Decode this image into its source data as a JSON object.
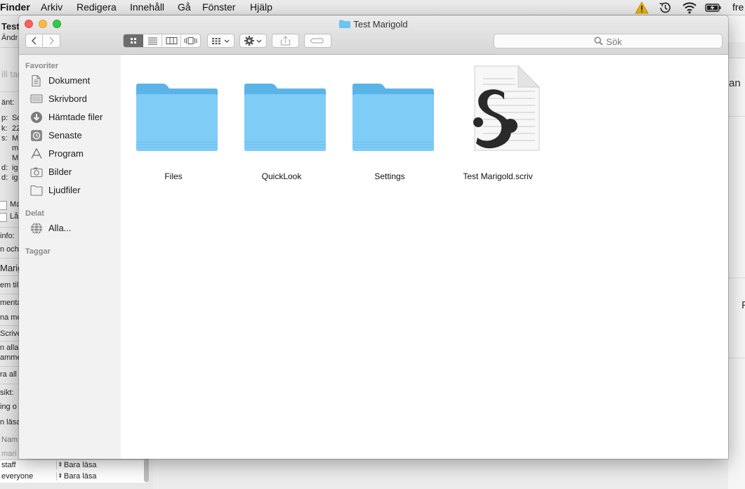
{
  "menubar": {
    "app_name": "Finder",
    "items": [
      "Arkiv",
      "Redigera",
      "Innehåll",
      "Gå",
      "Fönster",
      "Hjälp"
    ],
    "clock_partial": "fre"
  },
  "finder_window": {
    "title": "Test Marigold",
    "search_placeholder": "Sök",
    "sidebar": {
      "favorites_header": "Favoriter",
      "favorites": [
        {
          "label": "Dokument",
          "icon": "documents-icon"
        },
        {
          "label": "Skrivbord",
          "icon": "desktop-icon"
        },
        {
          "label": "Hämtade filer",
          "icon": "downloads-icon"
        },
        {
          "label": "Senaste",
          "icon": "recents-icon"
        },
        {
          "label": "Program",
          "icon": "applications-icon"
        },
        {
          "label": "Bilder",
          "icon": "pictures-icon"
        },
        {
          "label": "Ljudfiler",
          "icon": "music-icon"
        }
      ],
      "shared_header": "Delat",
      "shared": [
        {
          "label": "Alla...",
          "icon": "network-icon"
        }
      ],
      "tags_header": "Taggar"
    },
    "files": [
      {
        "name": "Files",
        "kind": "folder"
      },
      {
        "name": "QuickLook",
        "kind": "folder"
      },
      {
        "name": "Settings",
        "kind": "folder"
      },
      {
        "name": "Test Marigold.scriv",
        "kind": "scrivener-document"
      }
    ]
  },
  "background_info_window": {
    "fragments": [
      "Test",
      "Ändr",
      "ill tag",
      "änt:",
      "p:",
      "Sc",
      "k:",
      "22",
      "s:",
      "M",
      "m",
      "M",
      "d:",
      "ig",
      "d:",
      "ig",
      "Ma",
      "Lå",
      "info:",
      "n och",
      "Marig",
      "em till",
      "menta",
      "na me",
      "Scrive",
      "n alla",
      "amme",
      "ra all",
      "sikt:",
      "ing o",
      "n läsa",
      "Nam",
      "mari"
    ],
    "permissions": [
      {
        "name": "staff",
        "privilege": "Bara läsa"
      },
      {
        "name": "everyone",
        "privilege": "Bara läsa"
      }
    ]
  },
  "background_right_window": {
    "fragments": [
      "an",
      "P"
    ]
  },
  "colors": {
    "folder_blue": "#6cc4f4",
    "close": "#fc605b",
    "minimize": "#fdbc40",
    "zoom": "#34c84a",
    "warning": "#f5b300"
  }
}
